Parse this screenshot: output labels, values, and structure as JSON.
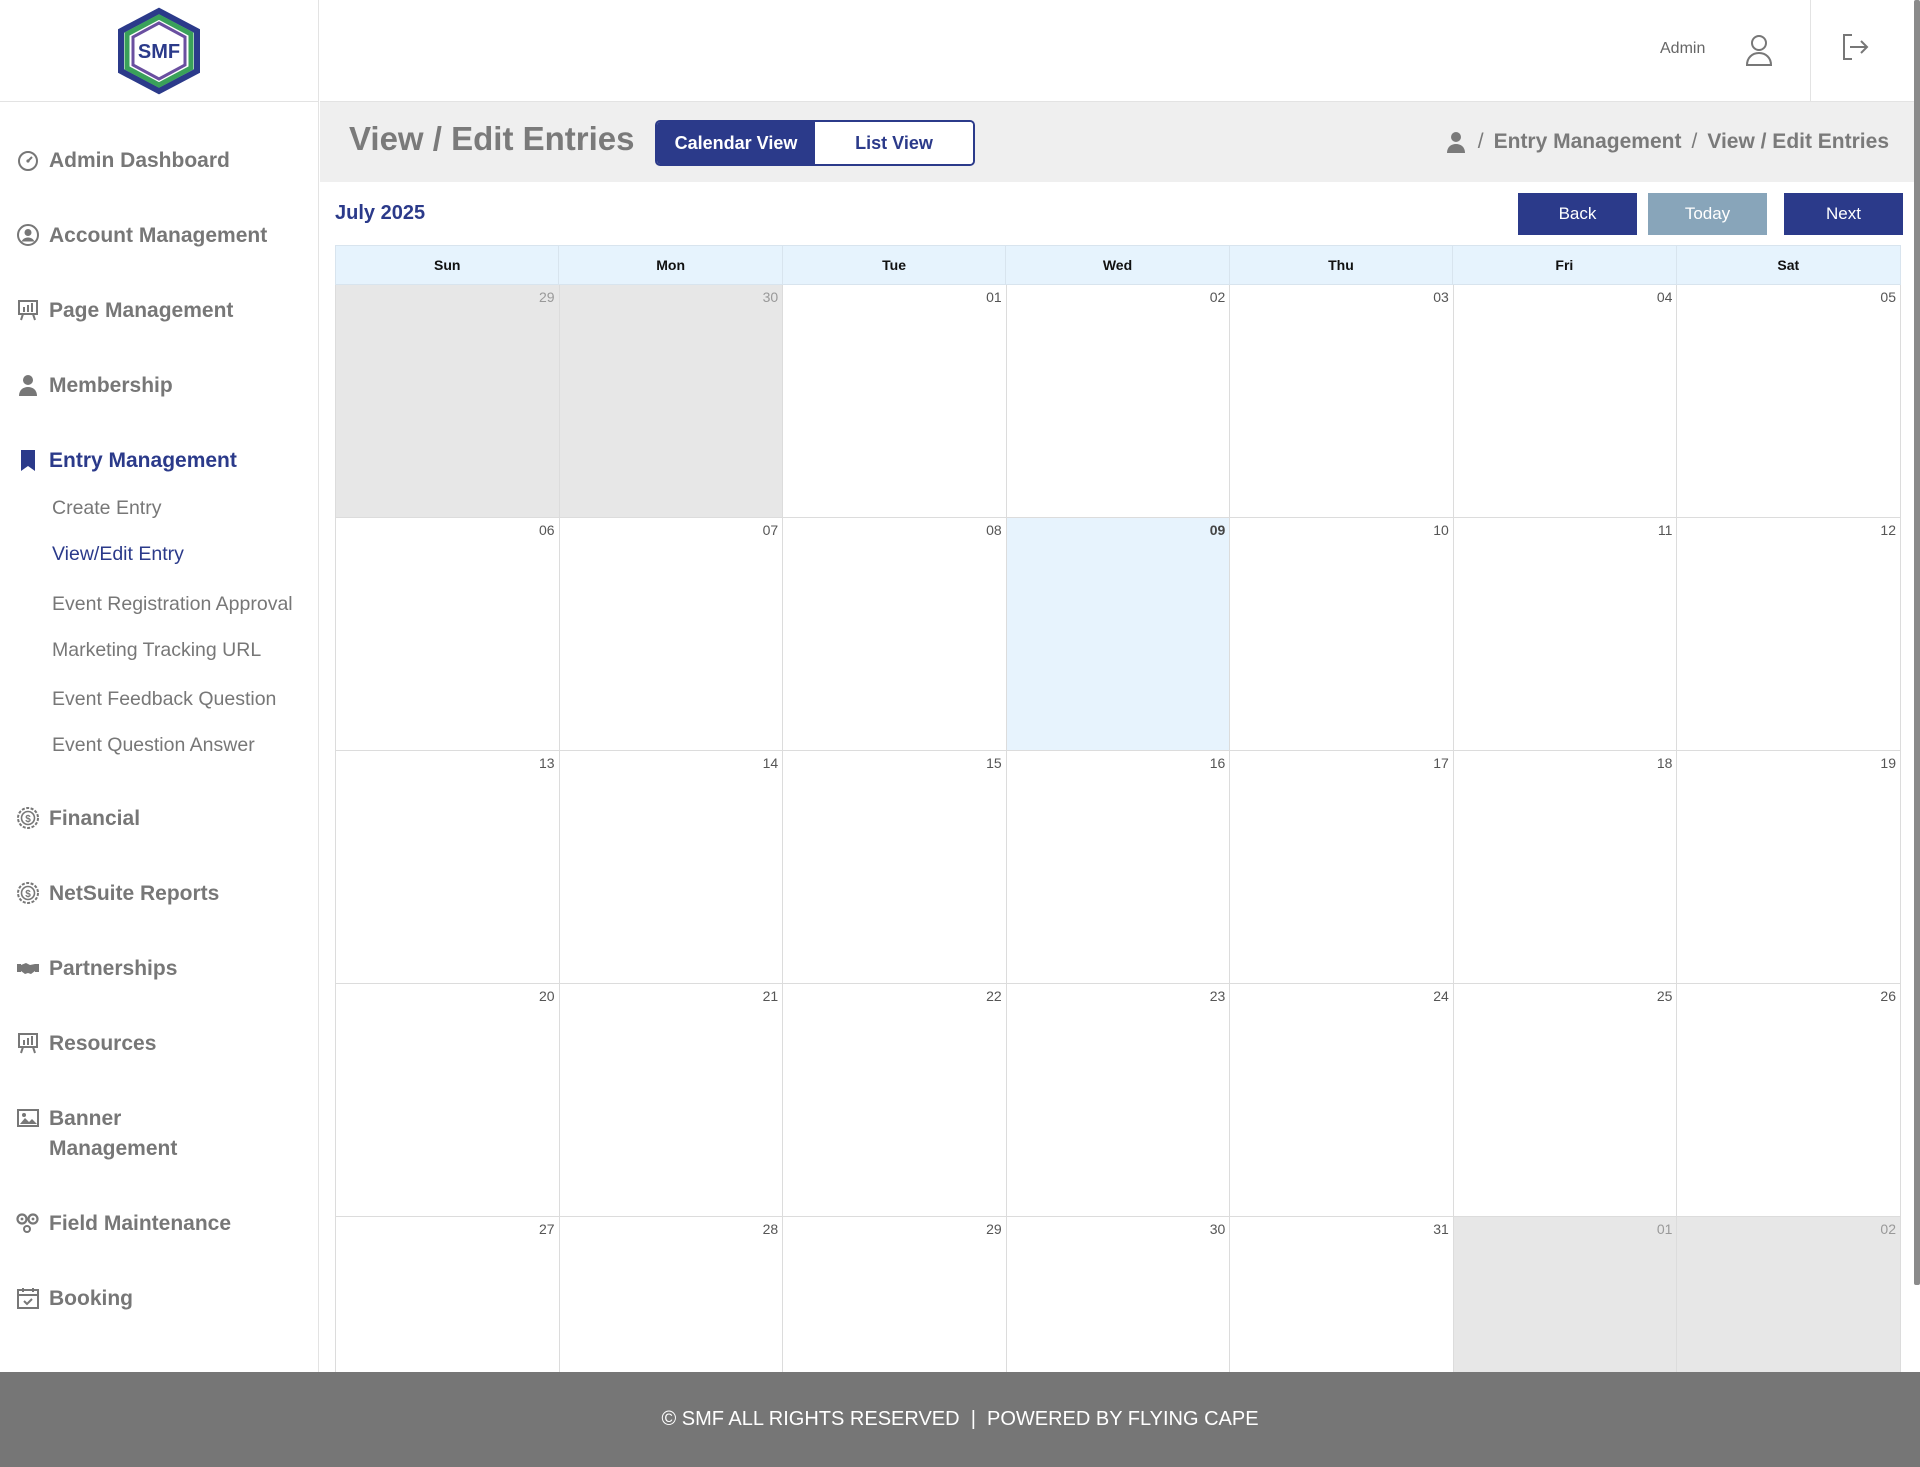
{
  "brand": {
    "logo_text": "SMF",
    "colors": {
      "primary": "#2b3a8a",
      "green": "#3aa15a",
      "today_btn": "#88a5ba"
    }
  },
  "sidebar": {
    "items": [
      {
        "label": "Admin Dashboard",
        "icon": "dashboard-gauge-icon"
      },
      {
        "label": "Account Management",
        "icon": "user-circle-icon"
      },
      {
        "label": "Page Management",
        "icon": "presentation-icon"
      },
      {
        "label": "Membership",
        "icon": "person-icon"
      },
      {
        "label": "Entry Management",
        "icon": "bookmark-icon",
        "active": true
      },
      {
        "label": "Financial",
        "icon": "dollar-gear-icon"
      },
      {
        "label": "NetSuite Reports",
        "icon": "dollar-gear-icon"
      },
      {
        "label": "Partnerships",
        "icon": "handshake-icon"
      },
      {
        "label": "Resources",
        "icon": "presentation-icon"
      },
      {
        "label": "Banner Management",
        "icon": "image-icon"
      },
      {
        "label": "Field Maintenance",
        "icon": "gears-icon"
      },
      {
        "label": "Booking",
        "icon": "calendar-check-icon"
      }
    ],
    "subitems": [
      {
        "label": "Create Entry"
      },
      {
        "label": "View/Edit Entry",
        "active": true
      },
      {
        "label": "Event Registration Approval"
      },
      {
        "label": "Marketing Tracking URL"
      },
      {
        "label": "Event Feedback Question"
      },
      {
        "label": "Event Question Answer"
      }
    ]
  },
  "topbar": {
    "user_name": "Admin",
    "user_icon": "user-outline-icon",
    "logout_icon": "logout-icon"
  },
  "header": {
    "title": "View / Edit Entries",
    "views": {
      "calendar": "Calendar View",
      "list": "List View"
    },
    "breadcrumb": {
      "icon": "person-icon",
      "sep": "/",
      "section": "Entry Management",
      "page": "View / Edit Entries"
    }
  },
  "calendar": {
    "month_label": "July 2025",
    "buttons": {
      "back": "Back",
      "today": "Today",
      "next": "Next"
    },
    "weekdays": [
      "Sun",
      "Mon",
      "Tue",
      "Wed",
      "Thu",
      "Fri",
      "Sat"
    ],
    "days": [
      {
        "n": "29",
        "state": "off"
      },
      {
        "n": "30",
        "state": "off"
      },
      {
        "n": "01"
      },
      {
        "n": "02"
      },
      {
        "n": "03"
      },
      {
        "n": "04"
      },
      {
        "n": "05"
      },
      {
        "n": "06"
      },
      {
        "n": "07"
      },
      {
        "n": "08"
      },
      {
        "n": "09",
        "state": "today"
      },
      {
        "n": "10"
      },
      {
        "n": "11"
      },
      {
        "n": "12"
      },
      {
        "n": "13"
      },
      {
        "n": "14"
      },
      {
        "n": "15"
      },
      {
        "n": "16"
      },
      {
        "n": "17"
      },
      {
        "n": "18"
      },
      {
        "n": "19"
      },
      {
        "n": "20"
      },
      {
        "n": "21"
      },
      {
        "n": "22"
      },
      {
        "n": "23"
      },
      {
        "n": "24"
      },
      {
        "n": "25"
      },
      {
        "n": "26"
      },
      {
        "n": "27"
      },
      {
        "n": "28"
      },
      {
        "n": "29"
      },
      {
        "n": "30"
      },
      {
        "n": "31"
      },
      {
        "n": "01",
        "state": "off"
      },
      {
        "n": "02",
        "state": "off"
      }
    ]
  },
  "footer": {
    "text": "© SMF ALL RIGHTS RESERVED  |  POWERED BY FLYING CAPE"
  }
}
